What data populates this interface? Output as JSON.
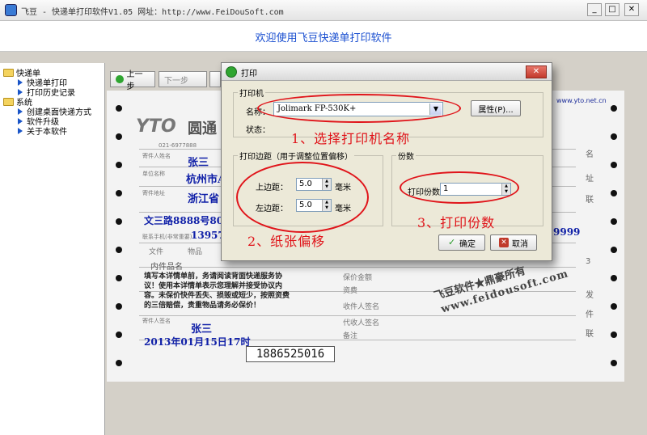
{
  "window": {
    "title": "飞豆 - 快递单打印软件V1.05  网址：http://www.FeiDouSoft.com",
    "min": "_",
    "max": "□",
    "close": "✕"
  },
  "banner": {
    "text": "欢迎使用飞豆快递单打印软件"
  },
  "sidebar": {
    "groups": [
      {
        "label": "快递单",
        "items": [
          "快递单打印",
          "打印历史记录"
        ]
      },
      {
        "label": "系统",
        "items": [
          "创建桌面快递方式",
          "软件升级",
          "关于本软件"
        ]
      }
    ]
  },
  "toolbar": {
    "prev": "上一步",
    "next": "下一步"
  },
  "waybill": {
    "logo_yt": "YTO",
    "logo_cn": "圆通",
    "phone_hint": "021-6977888",
    "site": "www.yto.net.cn",
    "sender_name_label": "寄件人姓名",
    "sender_name": "张三",
    "company_label": "单位名称",
    "company": "杭州市A",
    "address_label": "寄件地址",
    "province": "浙江省",
    "street": "文三路8888号801",
    "mobile_label": "联系手机(非常重要)",
    "mobile": "13957",
    "doc_label": "文件",
    "goods_label": "物品",
    "content_label": "内件品名",
    "agreement": "填写本详情单前，务请阅读背面快递服务协议！使用本详情单表示您理解并接受协议内容。未保价快件丢失、损毁或短少，按照资费的三倍赔偿，贵重物品请务必保价！",
    "sender_sign_label": "寄件人签名",
    "sender_sign": "张三",
    "date": "2013年01月15日17时",
    "phone_box": "1886525016",
    "insurance_label": "保价金额",
    "fee_label": "资费",
    "receiver_sign_label": "收件人签名",
    "agent_sign_label": "代收人签名",
    "remark_label": "备注",
    "dest_phone": "9999",
    "right_labels": [
      "名",
      "址",
      "联",
      "3",
      "发",
      "件",
      "联"
    ],
    "stamp_l1": "飞豆软件★鼎豪所有",
    "stamp_l2": "www.feidousoft.com"
  },
  "dialog": {
    "title": "打印",
    "printer_group": "打印机",
    "name_label": "名称：",
    "printer_name": "Jolimark FP-530K+",
    "properties": "属性(P)...",
    "status_label": "状态：",
    "margin_group": "打印边距（用于调整位置偏移）",
    "top_label": "上边距：",
    "top_value": "5.0",
    "left_label": "左边距：",
    "left_value": "5.0",
    "unit": "毫米",
    "copies_group": "份数",
    "copies_label": "打印份数",
    "copies_value": "1",
    "ok": "确定",
    "cancel": "取消"
  },
  "annotations": {
    "a1": "1、选择打印机名称",
    "a2": "2、纸张偏移",
    "a3": "3、打印份数",
    "color": "#e0141a"
  }
}
